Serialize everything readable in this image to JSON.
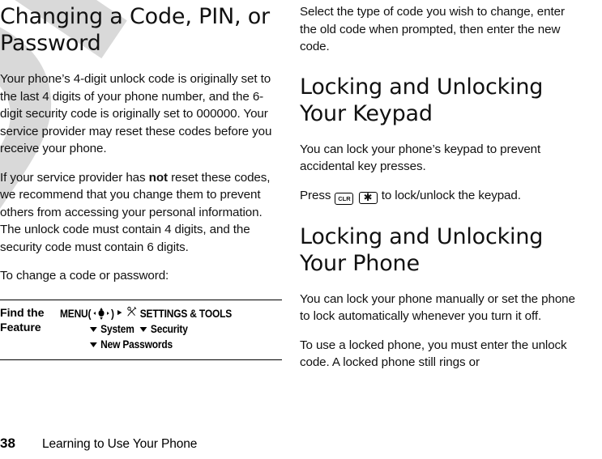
{
  "document": {
    "watermark_text": "DRAFT",
    "watermark_color": "#d9d9d9"
  },
  "left_column": {
    "heading": "Changing a Code, PIN, or Password",
    "paragraph_1": "Your phone’s 4-digit unlock code is originally set to the last 4 digits of your phone number, and the 6-digit security code is originally set to 000000. Your service provider may reset these codes before you receive your phone.",
    "paragraph_2_part_1": "If your service provider has ",
    "paragraph_2_bold": "not",
    "paragraph_2_part_2": " reset these codes, we recommend that you change them to prevent others from accessing your personal information. The unlock code must contain 4 digits, and the security code must contain 6 digits.",
    "paragraph_3": "To change a code or password:",
    "find_the_feature": {
      "label_line_1": "Find the",
      "label_line_2": "Feature",
      "menu_label": "MENU",
      "nav_key_open_paren": "(",
      "nav_key_close_paren": ")",
      "nav_key_icon": "five-way-navigation-key-icon",
      "path_separator": "▸",
      "tools_icon": "settings-and-tools-icon",
      "step_1": "SETTINGS & TOOLS",
      "step_2": "System",
      "step_3": "Security",
      "step_4": "New Passwords"
    }
  },
  "right_column": {
    "paragraph_1": "Select the type of code you wish to change, enter the old code when prompted, then enter the new code.",
    "heading_1": "Locking and Unlocking Your Keypad",
    "paragraph_2": "You can lock your phone’s keypad to prevent accidental key presses.",
    "press_line": {
      "prefix": "Press",
      "key_1_label": "CLR",
      "key_1_icon": "clear-key-icon",
      "key_2_label": "✳",
      "key_2_icon": "star-key-icon",
      "suffix": "to lock/unlock the keypad."
    },
    "heading_2": "Locking and Unlocking Your Phone",
    "paragraph_3": "You can lock your phone manually or set the phone to lock automatically whenever you turn it off.",
    "paragraph_4": "To use a locked phone, you must enter the unlock code. A locked phone still rings or"
  },
  "footer": {
    "page_number": "38",
    "running_head": "Learning to Use Your Phone"
  }
}
